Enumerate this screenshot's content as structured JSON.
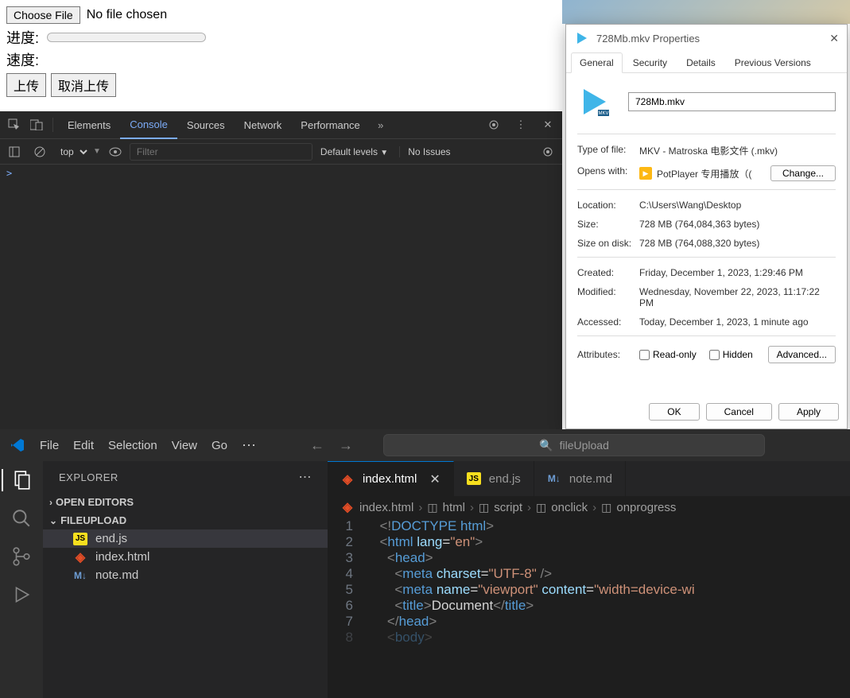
{
  "page": {
    "choose_file": "Choose File",
    "no_file": "No file chosen",
    "progress_label": "进度:",
    "speed_label": "速度:",
    "upload_btn": "上传",
    "cancel_btn": "取消上传"
  },
  "devtools": {
    "tabs": [
      "Elements",
      "Console",
      "Sources",
      "Network",
      "Performance"
    ],
    "active_tab": "Console",
    "context": "top",
    "filter_placeholder": "Filter",
    "levels": "Default levels",
    "no_issues": "No Issues",
    "prompt": ">"
  },
  "props": {
    "title": "728Mb.mkv Properties",
    "tabs": [
      "General",
      "Security",
      "Details",
      "Previous Versions"
    ],
    "active_tab": "General",
    "filename": "728Mb.mkv",
    "type_of_file_k": "Type of file:",
    "type_of_file_v": "MKV - Matroska 电影文件 (.mkv)",
    "opens_with_k": "Opens with:",
    "opens_with_v": "PotPlayer 专用播放（(",
    "change_btn": "Change...",
    "location_k": "Location:",
    "location_v": "C:\\Users\\Wang\\Desktop",
    "size_k": "Size:",
    "size_v": "728 MB (764,084,363 bytes)",
    "size_disk_k": "Size on disk:",
    "size_disk_v": "728 MB (764,088,320 bytes)",
    "created_k": "Created:",
    "created_v": "Friday, December 1, 2023, 1:29:46 PM",
    "modified_k": "Modified:",
    "modified_v": "Wednesday, November 22, 2023, 11:17:22 PM",
    "accessed_k": "Accessed:",
    "accessed_v": "Today, December 1, 2023, 1 minute ago",
    "attributes_k": "Attributes:",
    "read_only": "Read-only",
    "hidden": "Hidden",
    "advanced": "Advanced...",
    "ok": "OK",
    "cancel": "Cancel",
    "apply": "Apply"
  },
  "vscode": {
    "menus": [
      "File",
      "Edit",
      "Selection",
      "View",
      "Go"
    ],
    "search_text": "fileUpload",
    "explorer": "EXPLORER",
    "open_editors": "OPEN EDITORS",
    "folder": "FILEUPLOAD",
    "files": [
      "end.js",
      "index.html",
      "note.md"
    ],
    "tabs": [
      {
        "name": "index.html",
        "icon": "html"
      },
      {
        "name": "end.js",
        "icon": "js"
      },
      {
        "name": "note.md",
        "icon": "md"
      }
    ],
    "active_tab": "index.html",
    "breadcrumb": [
      "index.html",
      "html",
      "script",
      "onclick",
      "onprogress"
    ],
    "code": {
      "l1_a": "<!",
      "l1_b": "DOCTYPE",
      "l1_c": " html",
      "l1_d": ">",
      "l2_a": "<",
      "l2_b": "html ",
      "l2_c": "lang",
      "l2_d": "=",
      "l2_e": "\"en\"",
      "l2_f": ">",
      "l3_a": "<",
      "l3_b": "head",
      "l3_c": ">",
      "l4_a": "<",
      "l4_b": "meta ",
      "l4_c": "charset",
      "l4_d": "=",
      "l4_e": "\"UTF-8\"",
      "l4_f": " />",
      "l5_a": "<",
      "l5_b": "meta ",
      "l5_c": "name",
      "l5_d": "=",
      "l5_e": "\"viewport\"",
      "l5_f": " ",
      "l5_g": "content",
      "l5_h": "=",
      "l5_i": "\"width=device-wi",
      "l6_a": "<",
      "l6_b": "title",
      "l6_c": ">",
      "l6_d": "Document",
      "l6_e": "</",
      "l6_f": "title",
      "l6_g": ">",
      "l7_a": "</",
      "l7_b": "head",
      "l7_c": ">",
      "l8_a": "<",
      "l8_b": "body",
      "l8_c": ">"
    }
  }
}
